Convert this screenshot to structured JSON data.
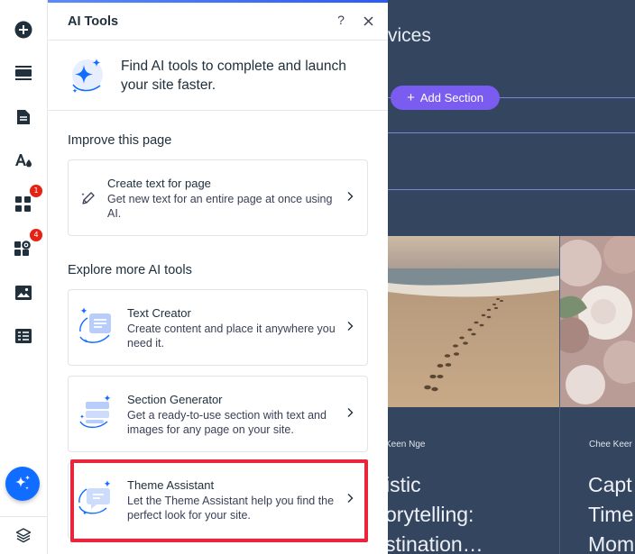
{
  "rail": {
    "items": [
      {
        "icon": "add-icon"
      },
      {
        "icon": "sections-icon"
      },
      {
        "icon": "pages-icon"
      },
      {
        "icon": "design-icon"
      },
      {
        "icon": "apps-icon",
        "badge": "1"
      },
      {
        "icon": "business-apps-icon",
        "badge": "4"
      },
      {
        "icon": "media-icon"
      },
      {
        "icon": "cms-icon"
      }
    ],
    "ai_button_icon": "sparkle-icon",
    "layers_icon": "layers-icon"
  },
  "panel": {
    "title": "AI Tools",
    "help": "?",
    "intro": "Find AI tools to complete and launch your site faster.",
    "improve_title": "Improve this page",
    "explore_title": "Explore more AI tools",
    "cards": [
      {
        "title": "Create text for page",
        "description": "Get new text for an entire page at once using AI."
      },
      {
        "title": "Text Creator",
        "description": "Create content and place it anywhere you need it."
      },
      {
        "title": "Section Generator",
        "description": "Get a ready-to-use section with text and images for any page on your site."
      },
      {
        "title": "Theme Assistant",
        "description": "Let the Theme Assistant help you find the perfect look for your site."
      }
    ]
  },
  "canvas": {
    "heading": "vices",
    "add_section": "Add Section",
    "posts": [
      {
        "author": "Keen Nge",
        "title_lines": [
          "istic",
          "orytelling:",
          "stination…"
        ]
      },
      {
        "author": "Chee Keer",
        "title_lines": [
          "Capt",
          "Time",
          "Mom"
        ]
      }
    ]
  },
  "colors": {
    "accent": "#116dff",
    "highlight": "#e8253a",
    "canvas_bg": "#34455f",
    "add_section_bg": "#7a5cf0",
    "badge": "#e62214"
  }
}
